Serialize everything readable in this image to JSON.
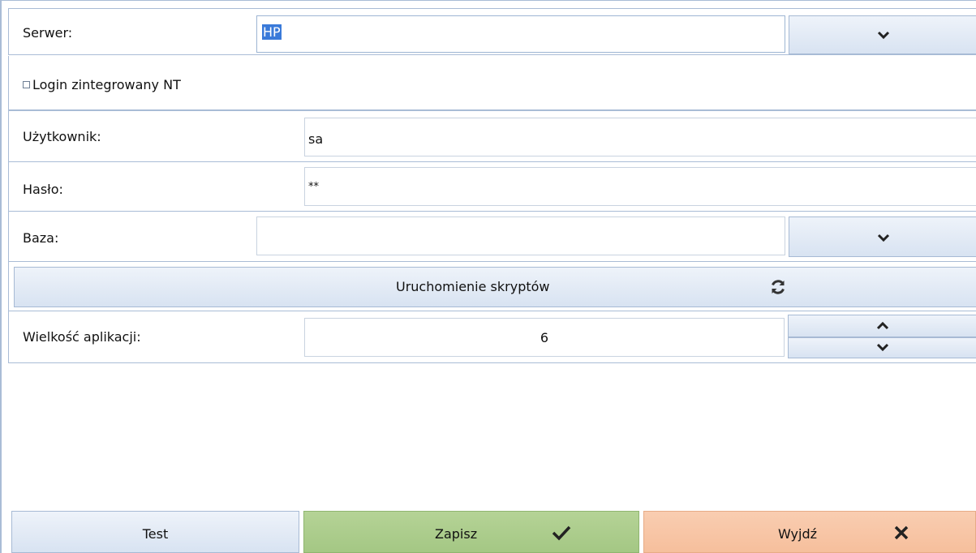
{
  "server": {
    "label": "Serwer:",
    "value": "HP",
    "dropdown_icon": "chevron-down-icon"
  },
  "integrated_login": {
    "label": "Login zintegrowany NT",
    "checked": false
  },
  "user": {
    "label": "Użytkownik:",
    "value": "sa"
  },
  "password": {
    "label": "Hasło:",
    "value": "**"
  },
  "database": {
    "label": "Baza:",
    "value": "",
    "dropdown_icon": "chevron-down-icon"
  },
  "run_scripts": {
    "label": "Uruchomienie skryptów",
    "icon": "refresh-icon"
  },
  "app_size": {
    "label": "Wielkość aplikacji:",
    "value": "6",
    "up_icon": "chevron-up-icon",
    "down_icon": "chevron-down-icon"
  },
  "footer": {
    "test_label": "Test",
    "save_label": "Zapisz",
    "save_icon": "checkmark-icon",
    "exit_label": "Wyjdź",
    "exit_icon": "close-icon"
  },
  "colors": {
    "border": "#a9bcd6",
    "button_blue": "#e2eaf5",
    "button_green": "#a9cb89",
    "button_orange": "#f7c4a4",
    "selection": "#3a7ad9"
  }
}
